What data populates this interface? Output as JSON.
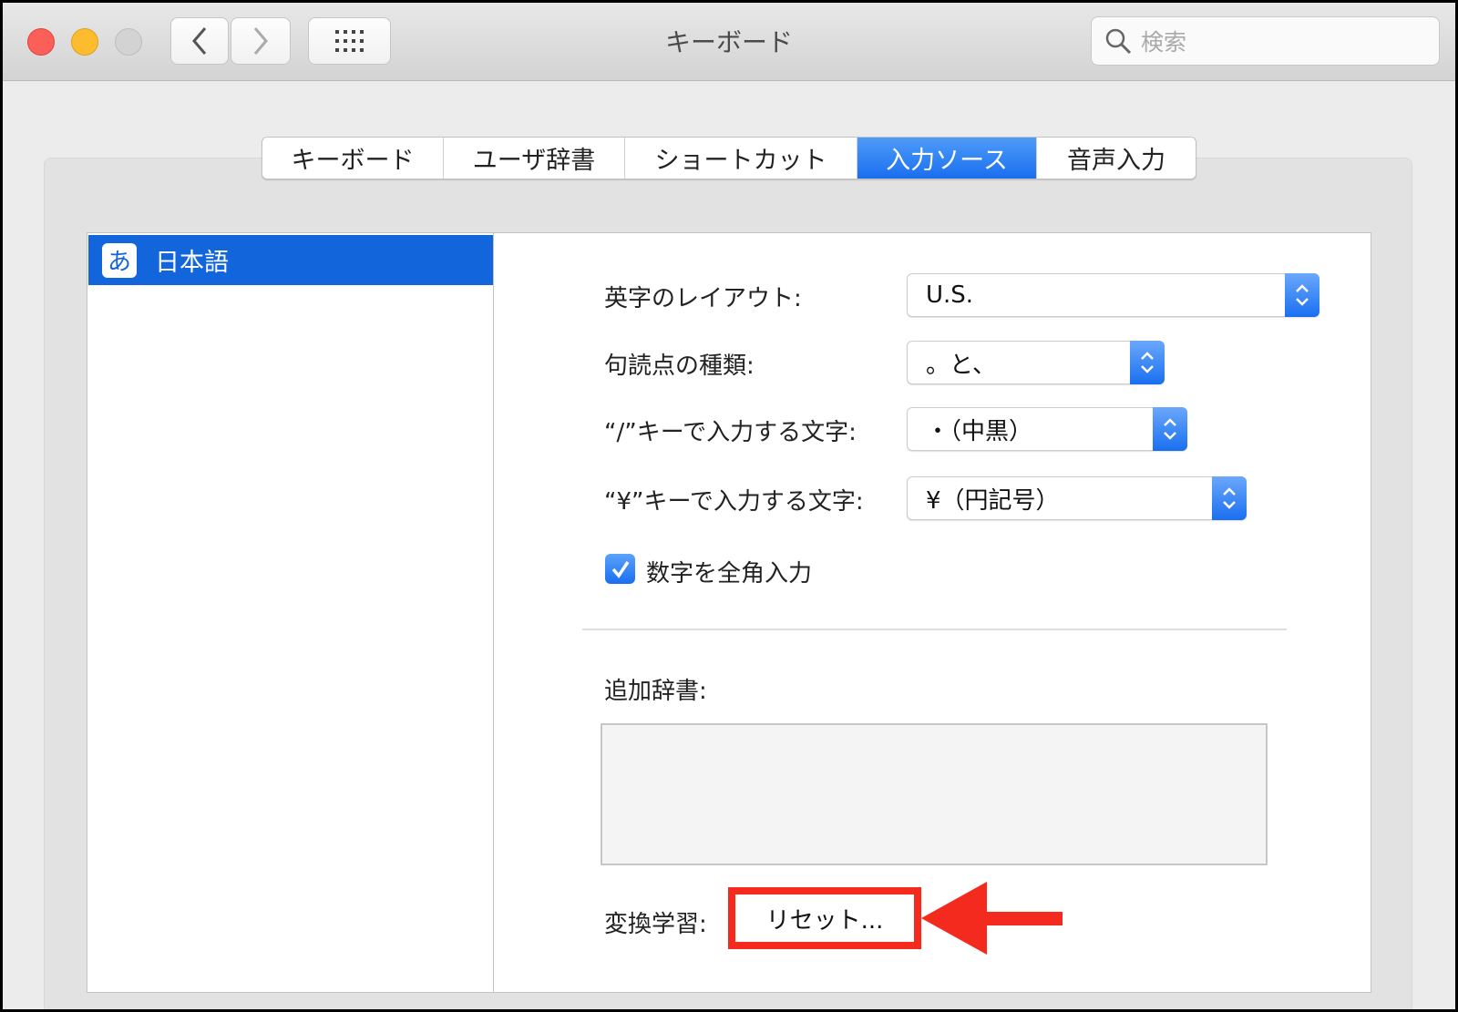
{
  "window": {
    "title": "キーボード",
    "search_placeholder": "検索"
  },
  "tabs": [
    {
      "label": "キーボード",
      "active": false
    },
    {
      "label": "ユーザ辞書",
      "active": false
    },
    {
      "label": "ショートカット",
      "active": false
    },
    {
      "label": "入力ソース",
      "active": true
    },
    {
      "label": "音声入力",
      "active": false
    }
  ],
  "sources": [
    {
      "icon": "あ",
      "label": "日本語",
      "selected": true
    }
  ],
  "settings": {
    "layout": {
      "label": "英字のレイアウト:",
      "value": "U.S."
    },
    "punctuation": {
      "label": "句読点の種類:",
      "value": "。と、"
    },
    "slash_key": {
      "label": "“/”キーで入力する文字:",
      "value": "・（中黒）"
    },
    "yen_key": {
      "label": "“¥”キーで入力する文字:",
      "value": "¥（円記号）"
    },
    "fullwidth_numbers": {
      "label": "数字を全角入力",
      "checked": true
    },
    "dictionaries_label": "追加辞書:",
    "learning_label": "変換学習:",
    "reset_button": "リセット..."
  },
  "colors": {
    "accent": "#1265db",
    "highlight": "#f42a1f"
  }
}
